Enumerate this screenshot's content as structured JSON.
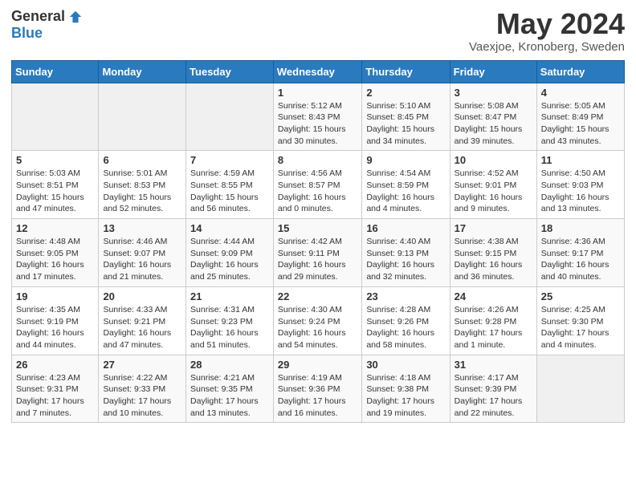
{
  "header": {
    "logo_general": "General",
    "logo_blue": "Blue",
    "month_title": "May 2024",
    "subtitle": "Vaexjoe, Kronoberg, Sweden"
  },
  "days_of_week": [
    "Sunday",
    "Monday",
    "Tuesday",
    "Wednesday",
    "Thursday",
    "Friday",
    "Saturday"
  ],
  "weeks": [
    [
      {
        "day": "",
        "info": ""
      },
      {
        "day": "",
        "info": ""
      },
      {
        "day": "",
        "info": ""
      },
      {
        "day": "1",
        "info": "Sunrise: 5:12 AM\nSunset: 8:43 PM\nDaylight: 15 hours\nand 30 minutes."
      },
      {
        "day": "2",
        "info": "Sunrise: 5:10 AM\nSunset: 8:45 PM\nDaylight: 15 hours\nand 34 minutes."
      },
      {
        "day": "3",
        "info": "Sunrise: 5:08 AM\nSunset: 8:47 PM\nDaylight: 15 hours\nand 39 minutes."
      },
      {
        "day": "4",
        "info": "Sunrise: 5:05 AM\nSunset: 8:49 PM\nDaylight: 15 hours\nand 43 minutes."
      }
    ],
    [
      {
        "day": "5",
        "info": "Sunrise: 5:03 AM\nSunset: 8:51 PM\nDaylight: 15 hours\nand 47 minutes."
      },
      {
        "day": "6",
        "info": "Sunrise: 5:01 AM\nSunset: 8:53 PM\nDaylight: 15 hours\nand 52 minutes."
      },
      {
        "day": "7",
        "info": "Sunrise: 4:59 AM\nSunset: 8:55 PM\nDaylight: 15 hours\nand 56 minutes."
      },
      {
        "day": "8",
        "info": "Sunrise: 4:56 AM\nSunset: 8:57 PM\nDaylight: 16 hours\nand 0 minutes."
      },
      {
        "day": "9",
        "info": "Sunrise: 4:54 AM\nSunset: 8:59 PM\nDaylight: 16 hours\nand 4 minutes."
      },
      {
        "day": "10",
        "info": "Sunrise: 4:52 AM\nSunset: 9:01 PM\nDaylight: 16 hours\nand 9 minutes."
      },
      {
        "day": "11",
        "info": "Sunrise: 4:50 AM\nSunset: 9:03 PM\nDaylight: 16 hours\nand 13 minutes."
      }
    ],
    [
      {
        "day": "12",
        "info": "Sunrise: 4:48 AM\nSunset: 9:05 PM\nDaylight: 16 hours\nand 17 minutes."
      },
      {
        "day": "13",
        "info": "Sunrise: 4:46 AM\nSunset: 9:07 PM\nDaylight: 16 hours\nand 21 minutes."
      },
      {
        "day": "14",
        "info": "Sunrise: 4:44 AM\nSunset: 9:09 PM\nDaylight: 16 hours\nand 25 minutes."
      },
      {
        "day": "15",
        "info": "Sunrise: 4:42 AM\nSunset: 9:11 PM\nDaylight: 16 hours\nand 29 minutes."
      },
      {
        "day": "16",
        "info": "Sunrise: 4:40 AM\nSunset: 9:13 PM\nDaylight: 16 hours\nand 32 minutes."
      },
      {
        "day": "17",
        "info": "Sunrise: 4:38 AM\nSunset: 9:15 PM\nDaylight: 16 hours\nand 36 minutes."
      },
      {
        "day": "18",
        "info": "Sunrise: 4:36 AM\nSunset: 9:17 PM\nDaylight: 16 hours\nand 40 minutes."
      }
    ],
    [
      {
        "day": "19",
        "info": "Sunrise: 4:35 AM\nSunset: 9:19 PM\nDaylight: 16 hours\nand 44 minutes."
      },
      {
        "day": "20",
        "info": "Sunrise: 4:33 AM\nSunset: 9:21 PM\nDaylight: 16 hours\nand 47 minutes."
      },
      {
        "day": "21",
        "info": "Sunrise: 4:31 AM\nSunset: 9:23 PM\nDaylight: 16 hours\nand 51 minutes."
      },
      {
        "day": "22",
        "info": "Sunrise: 4:30 AM\nSunset: 9:24 PM\nDaylight: 16 hours\nand 54 minutes."
      },
      {
        "day": "23",
        "info": "Sunrise: 4:28 AM\nSunset: 9:26 PM\nDaylight: 16 hours\nand 58 minutes."
      },
      {
        "day": "24",
        "info": "Sunrise: 4:26 AM\nSunset: 9:28 PM\nDaylight: 17 hours\nand 1 minute."
      },
      {
        "day": "25",
        "info": "Sunrise: 4:25 AM\nSunset: 9:30 PM\nDaylight: 17 hours\nand 4 minutes."
      }
    ],
    [
      {
        "day": "26",
        "info": "Sunrise: 4:23 AM\nSunset: 9:31 PM\nDaylight: 17 hours\nand 7 minutes."
      },
      {
        "day": "27",
        "info": "Sunrise: 4:22 AM\nSunset: 9:33 PM\nDaylight: 17 hours\nand 10 minutes."
      },
      {
        "day": "28",
        "info": "Sunrise: 4:21 AM\nSunset: 9:35 PM\nDaylight: 17 hours\nand 13 minutes."
      },
      {
        "day": "29",
        "info": "Sunrise: 4:19 AM\nSunset: 9:36 PM\nDaylight: 17 hours\nand 16 minutes."
      },
      {
        "day": "30",
        "info": "Sunrise: 4:18 AM\nSunset: 9:38 PM\nDaylight: 17 hours\nand 19 minutes."
      },
      {
        "day": "31",
        "info": "Sunrise: 4:17 AM\nSunset: 9:39 PM\nDaylight: 17 hours\nand 22 minutes."
      },
      {
        "day": "",
        "info": ""
      }
    ]
  ]
}
